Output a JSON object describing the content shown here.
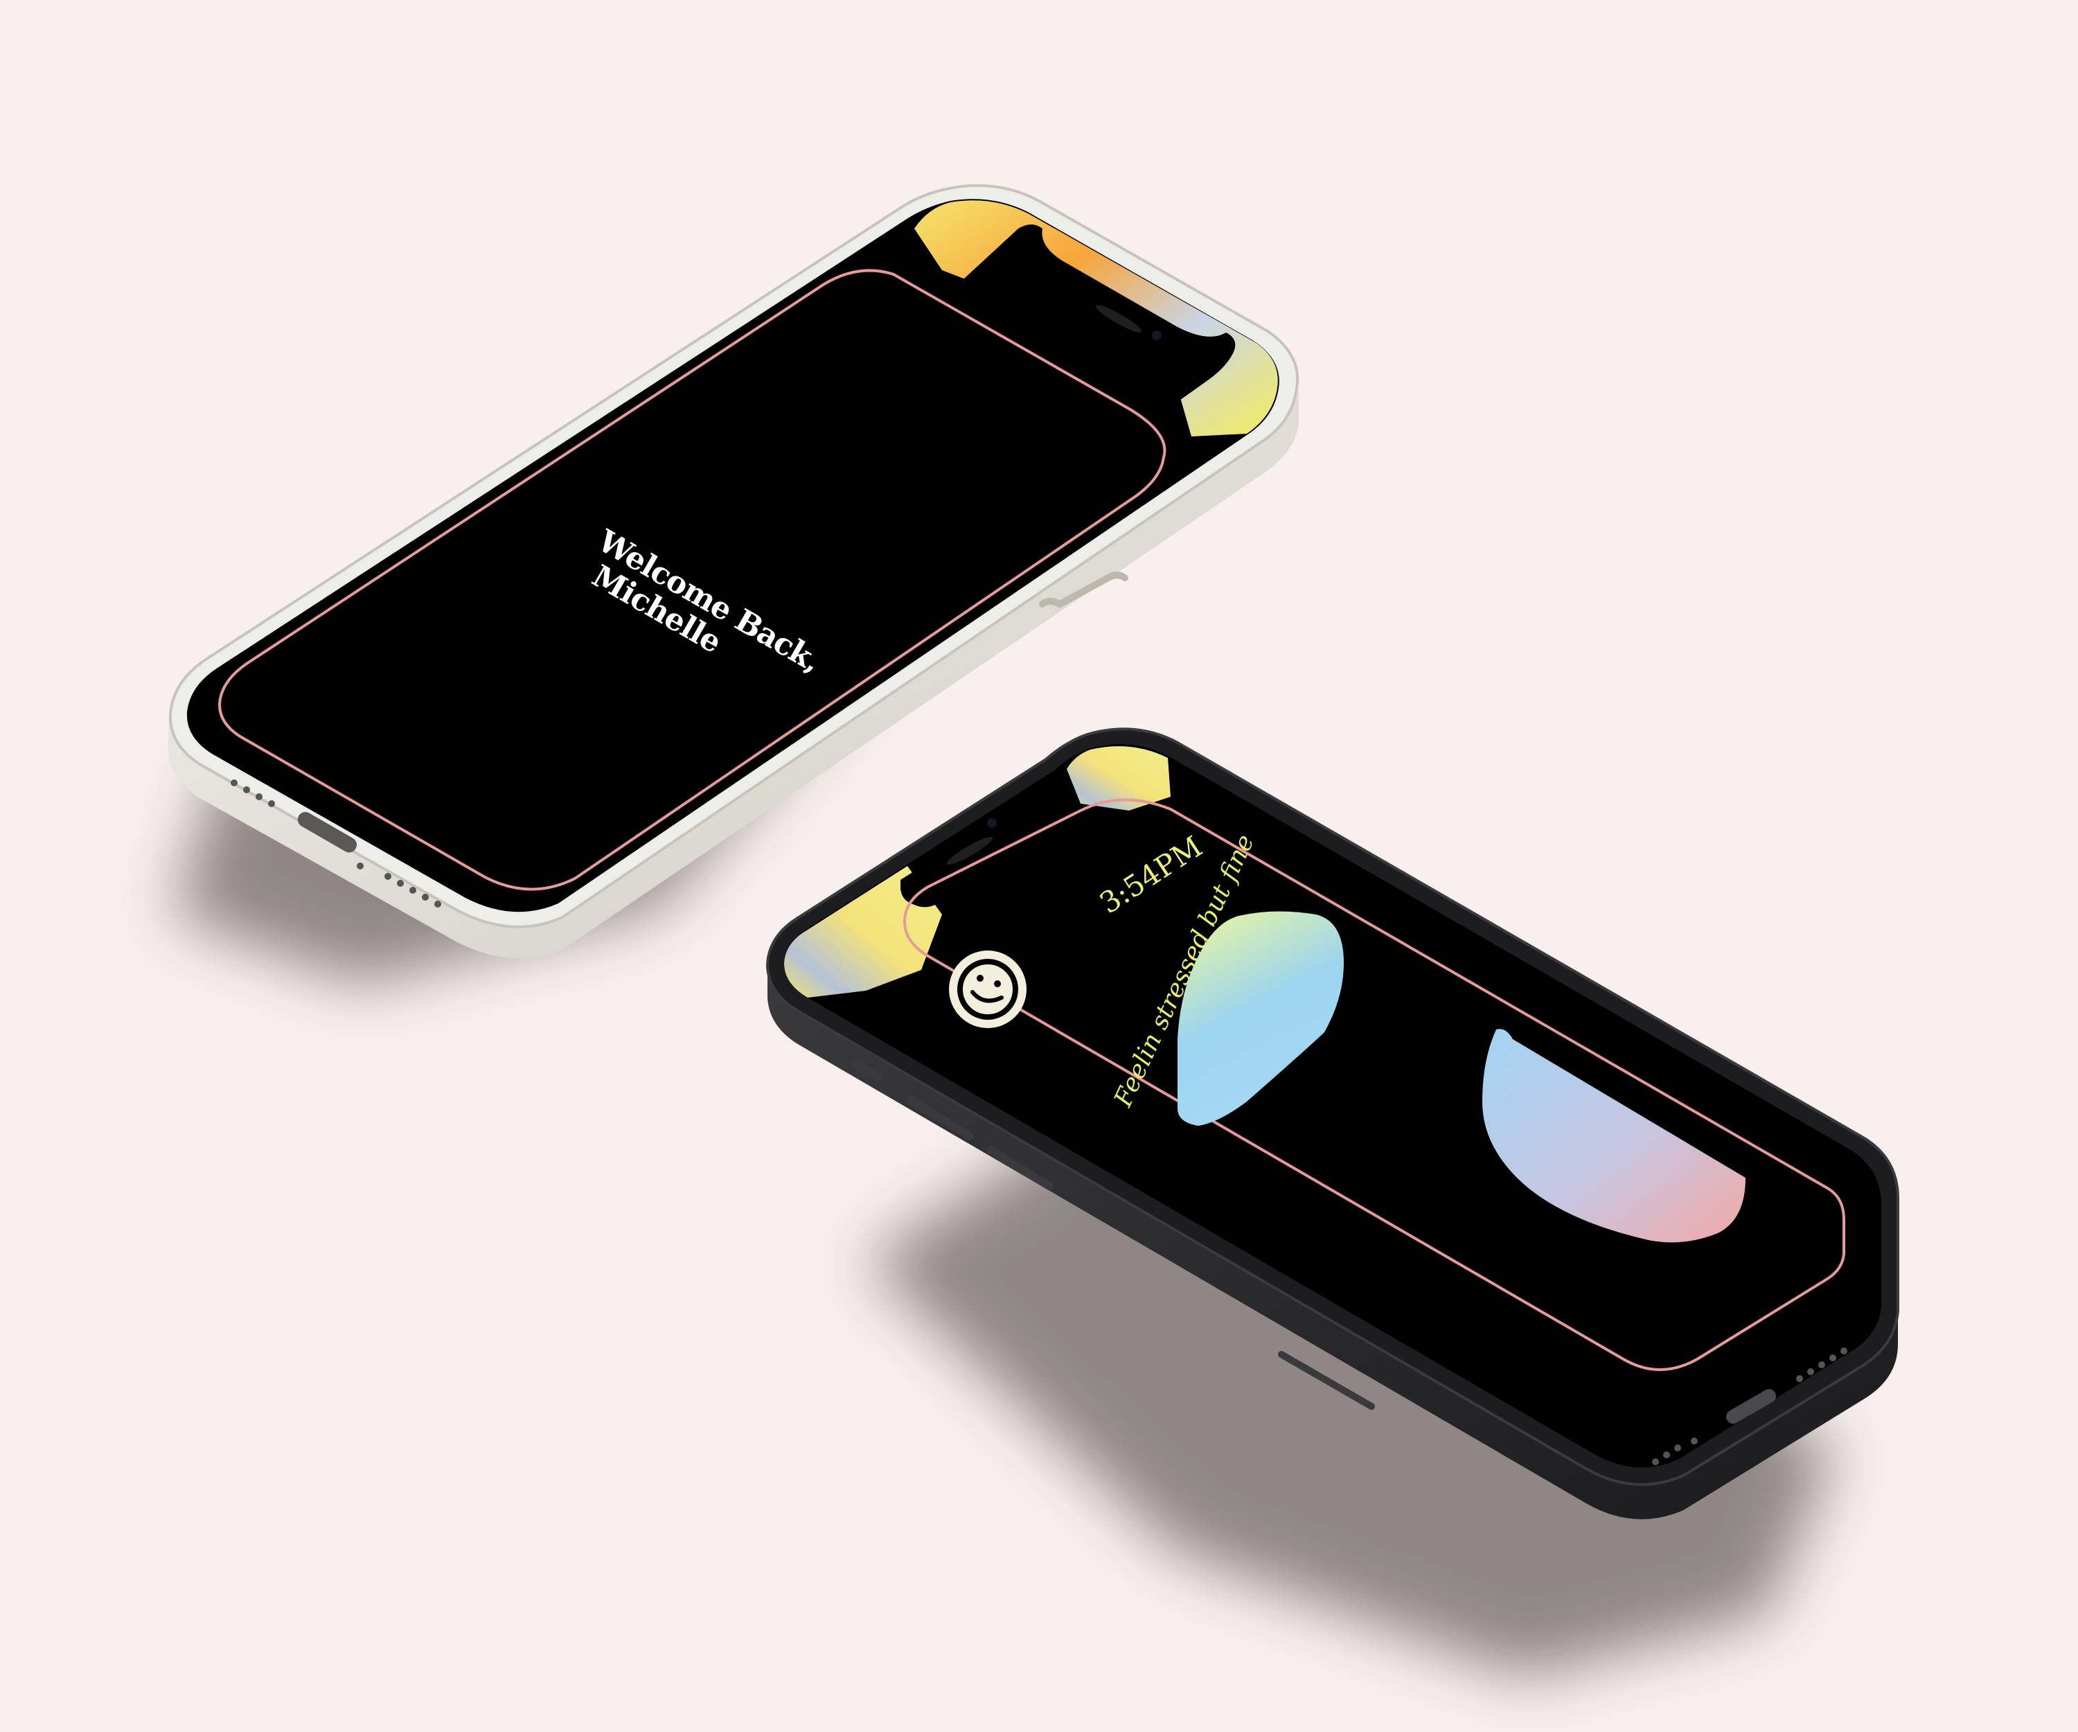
{
  "background_color": "#f9efef",
  "phone_top": {
    "frame_color": "#e9e6df",
    "screen_color": "#000000",
    "border_accent": "#e79a9a",
    "welcome_line_1": "Welcome Back,",
    "welcome_line_2": "Michelle"
  },
  "phone_bottom": {
    "frame_color": "#2a2a2d",
    "screen_color": "#000000",
    "border_accent": "#e79a9a",
    "time": "3:54PM",
    "mood_text": "Feelin stressed but fine",
    "mood_icon": "smiley-face-icon",
    "accent_text_color": "#ecf27a"
  }
}
